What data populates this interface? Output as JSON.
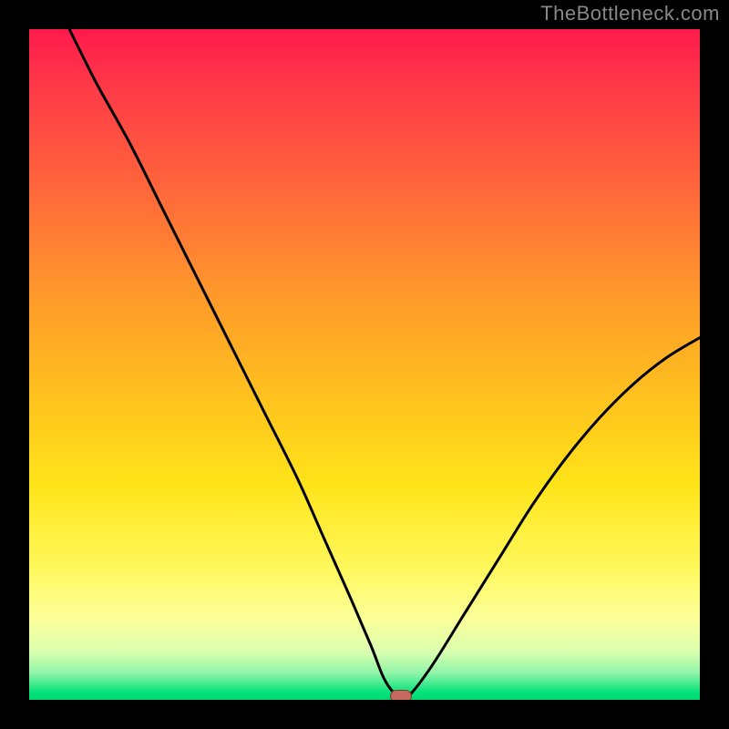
{
  "watermark": "TheBottleneck.com",
  "colors": {
    "frame": "#000000",
    "gradient_top": "#ff1a4d",
    "gradient_bottom": "#00d870",
    "curve": "#000000",
    "marker_fill": "#c66a5e",
    "marker_border": "#7c3a32"
  },
  "chart_data": {
    "type": "line",
    "title": "",
    "xlabel": "",
    "ylabel": "",
    "xlim": [
      0,
      100
    ],
    "ylim": [
      0,
      100
    ],
    "grid": false,
    "legend": false,
    "background": "vertical-gradient red→green",
    "series": [
      {
        "name": "bottleneck-curve",
        "x": [
          6,
          10,
          15,
          20,
          25,
          30,
          35,
          40,
          44,
          48,
          51,
          53,
          55,
          56.5,
          60,
          65,
          70,
          75,
          80,
          85,
          90,
          95,
          100
        ],
        "y": [
          100,
          92,
          83,
          73,
          63,
          53,
          43,
          33,
          24,
          15,
          8,
          3,
          0.5,
          0.5,
          5,
          13,
          21,
          29,
          36,
          42,
          47,
          51,
          54
        ]
      }
    ],
    "flat_valley_x_range": [
      53,
      56.5
    ],
    "marker": {
      "x": 55.5,
      "y": 0.5
    },
    "notes": "Values are visual estimates read from the unlabeled chart; y uses 0=bottom, 100=top of the gradient plot area."
  }
}
